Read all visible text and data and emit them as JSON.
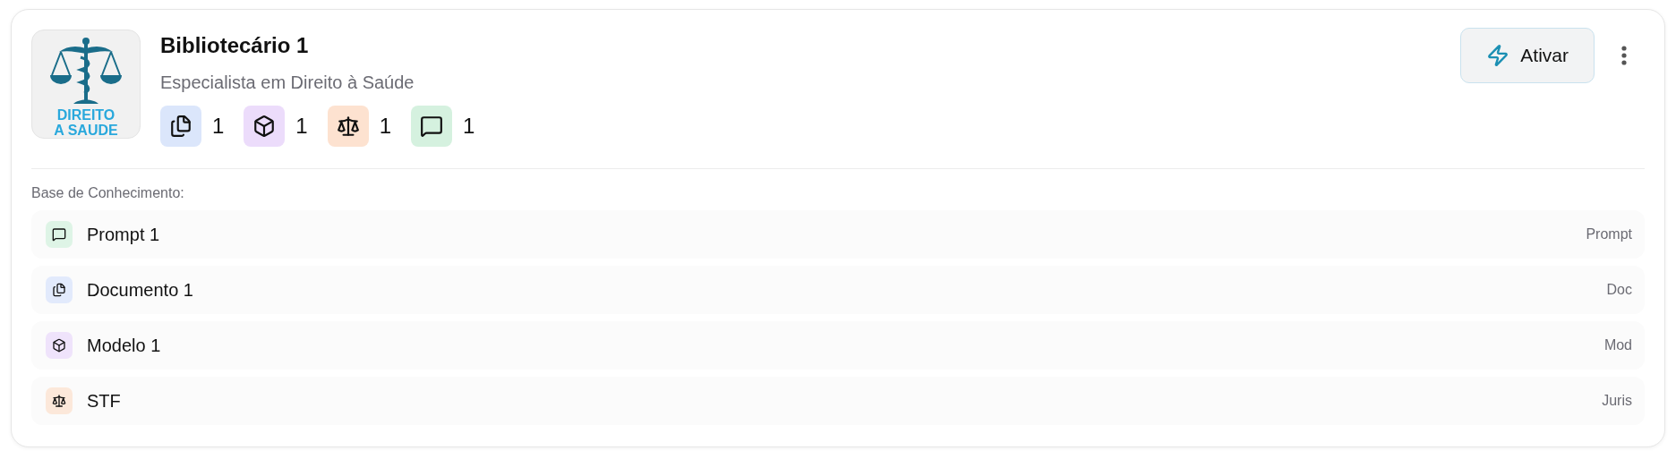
{
  "agent": {
    "logo_text": [
      "DIREITO",
      "A SAUDE"
    ],
    "name": "Bibliotecário 1",
    "subtitle": "Especialista em Direito à Saúde",
    "counts": [
      {
        "kind": "doc",
        "count": "1"
      },
      {
        "kind": "model",
        "count": "1"
      },
      {
        "kind": "juris",
        "count": "1"
      },
      {
        "kind": "prompt",
        "count": "1"
      }
    ],
    "activate_button": "Ativar"
  },
  "knowledge_base": {
    "title": "Base de Conhecimento:",
    "items": [
      {
        "kind": "prompt",
        "label": "Prompt 1",
        "type": "Prompt"
      },
      {
        "kind": "doc",
        "label": "Documento 1",
        "type": "Doc"
      },
      {
        "kind": "model",
        "label": "Modelo 1",
        "type": "Mod"
      },
      {
        "kind": "juris",
        "label": "STF",
        "type": "Juris"
      }
    ]
  }
}
